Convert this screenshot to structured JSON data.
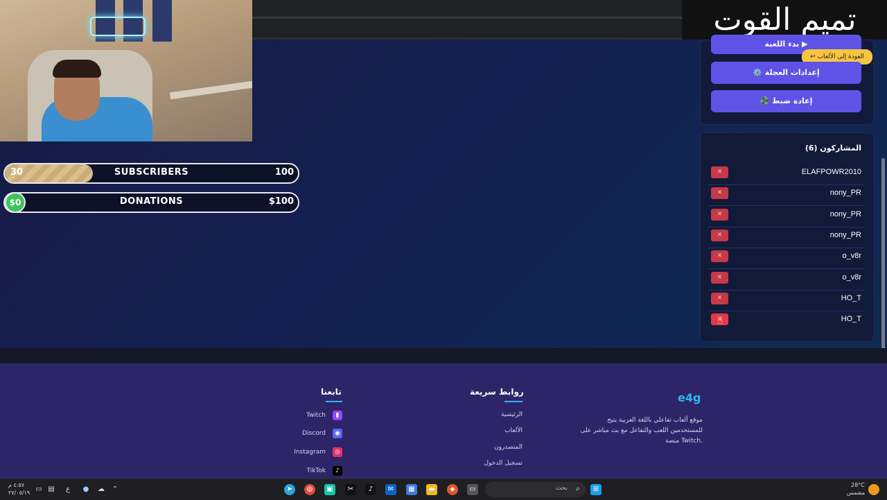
{
  "stream_overlay": {
    "subscribers": {
      "current": "30",
      "label": "SUBSCRIBERS",
      "goal": "100",
      "fraction": 0.3
    },
    "donations": {
      "current": "$0",
      "label": "DONATIONS",
      "goal": "$100",
      "fraction": 0.0
    },
    "overlay_title": "تميم القوت"
  },
  "game": {
    "start_button": "بدء اللعبة ▶",
    "back_tooltip": "↩ العودة إلى الألعاب",
    "wheel_settings_button": "⚙️ إعدادات العجلة",
    "reset_button": "♻️ إعادة ضبط",
    "participants_title": "المشاركون (6)",
    "remove_label": "✕",
    "participants": [
      "ELAFPOWR2010",
      "nony_PR",
      "nony_PR",
      "nony_PR",
      "o_v8r",
      "o_v8r",
      "HO_T",
      "HO_T"
    ]
  },
  "footer": {
    "brand": "e4g",
    "description_lines": [
      "موقع ألعاب تفاعلي باللغة العربية يتيح",
      "للمستخدمين اللعب والتفاعل مع بث مباشر على",
      "منصة Twitch."
    ],
    "quick_links_title": "روابط سريعة",
    "quick_links": [
      "الرئيسية",
      "الألعاب",
      "المتصدرون",
      "تسجيل الدخول"
    ],
    "follow_title": "تابعنا",
    "social": [
      {
        "label": "Twitch",
        "icon": "twitch-icon",
        "color": "#9146ff"
      },
      {
        "label": "Discord",
        "icon": "discord-icon",
        "color": "#5865f2"
      },
      {
        "label": "Instagram",
        "icon": "instagram-icon",
        "color": "#e1306c"
      },
      {
        "label": "TikTok",
        "icon": "tiktok-icon",
        "color": "#000000"
      }
    ]
  },
  "taskbar": {
    "search_placeholder": "بحث",
    "weather_temp": "28°C",
    "weather_text": "مشمس",
    "time": "٤:٥٧ م",
    "date": "٢٧/٠٥/١٩",
    "lang": "ع"
  },
  "colors": {
    "accent": "#5f52e6",
    "danger": "#c43a48",
    "footer": "#2e2569",
    "link_accent": "#2fb6f0"
  }
}
